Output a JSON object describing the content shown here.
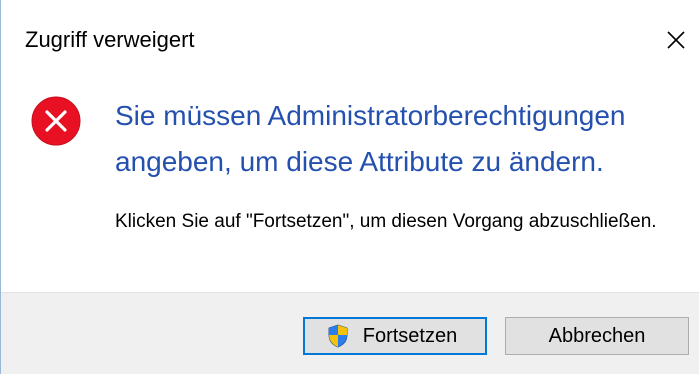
{
  "dialog": {
    "title": "Zugriff verweigert",
    "main_instruction": "Sie müssen Administratorberechtigungen angeben, um diese Attribute zu ändern.",
    "content": "Klicken Sie auf \"Fortsetzen\", um diesen Vorgang abzuschließen.",
    "icon": "error-icon"
  },
  "buttons": {
    "continue_label": "Fortsetzen",
    "continue_icon": "uac-shield-icon",
    "cancel_label": "Abbrechen"
  },
  "colors": {
    "instruction_text": "#2450ae",
    "error_red": "#e81123",
    "focus_border": "#0078d7",
    "footer_bg": "#f0f0f0"
  }
}
